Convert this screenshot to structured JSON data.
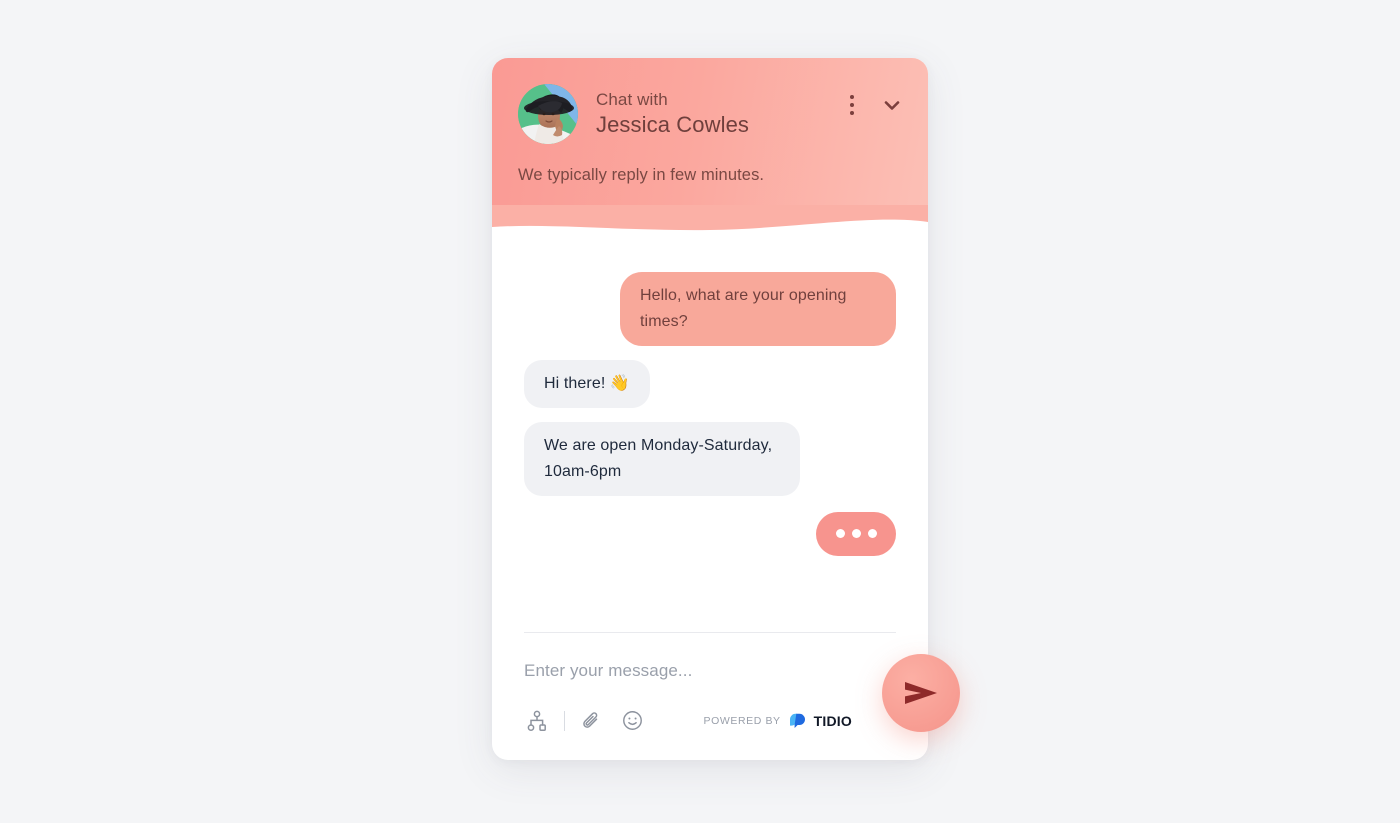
{
  "widget": {
    "header": {
      "chat_with_label": "Chat with",
      "agent_name": "Jessica Cowles",
      "reply_time": "We typically reply in few minutes.",
      "avatar_alt": "agent-avatar-photo",
      "menu_icon": "more-vertical-icon",
      "minimize_icon": "chevron-down-icon",
      "gradient_from": "#fa9a94",
      "gradient_to": "#fcc0b6",
      "text_color": "#7a4843"
    },
    "messages": [
      {
        "id": "m1",
        "from": "visitor",
        "text": "Hello, what are your opening times?"
      },
      {
        "id": "m2",
        "from": "agent",
        "text": "Hi there! 👋"
      },
      {
        "id": "m3",
        "from": "agent",
        "text": "We are open Monday-Saturday, 10am-6pm"
      }
    ],
    "typing_indicator": {
      "visible": true,
      "dots": 3,
      "bubble_color": "#f7948e"
    },
    "composer": {
      "input_value": "",
      "placeholder": "Enter your message...",
      "tools": [
        {
          "name": "flow-chart-icon",
          "label": "Chatbot flows"
        },
        {
          "name": "paperclip-icon",
          "label": "Attach file"
        },
        {
          "name": "emoji-icon",
          "label": "Insert emoji"
        }
      ],
      "send_icon": "send-paper-plane-icon",
      "send_color": "#f79c92"
    },
    "footer": {
      "powered_by_label": "POWERED BY",
      "brand_name": "TIDIO",
      "brand_mark": "tidio-logo-icon",
      "brand_color": "#2f7ef5"
    }
  },
  "page": {
    "background": "#f4f5f7"
  }
}
